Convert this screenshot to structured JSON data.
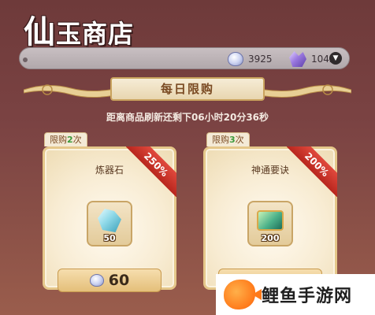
{
  "header": {
    "title_big": "仙",
    "title_rest": "玉商店"
  },
  "currency": {
    "jade_icon": "jade-currency-icon",
    "jade_amount": "3925",
    "crystal_icon": "purple-crystal-icon",
    "crystal_amount": "1042",
    "dropdown_icon": "chevron-down-icon"
  },
  "banner": {
    "title": "每日限购"
  },
  "countdown": {
    "text": "距离商品刷新还剩下06小时20分36秒"
  },
  "items": [
    {
      "limit_prefix": "限购",
      "limit_count": "2",
      "limit_suffix": "次",
      "name": "炼器石",
      "discount": "250%",
      "icon": "refining-stone-icon",
      "quantity": "50",
      "price": "60"
    },
    {
      "limit_prefix": "限购",
      "limit_count": "3",
      "limit_suffix": "次",
      "name": "神通要诀",
      "discount": "200%",
      "icon": "skill-scroll-icon",
      "quantity": "200",
      "price": ""
    }
  ],
  "watermark": {
    "text": "鲤鱼手游网",
    "logo": "carp-logo-icon"
  },
  "colors": {
    "background": "#7b4343",
    "limit_green": "#3c9a3c",
    "discount_red": "#c8322a",
    "card_border": "#e5c78a"
  }
}
